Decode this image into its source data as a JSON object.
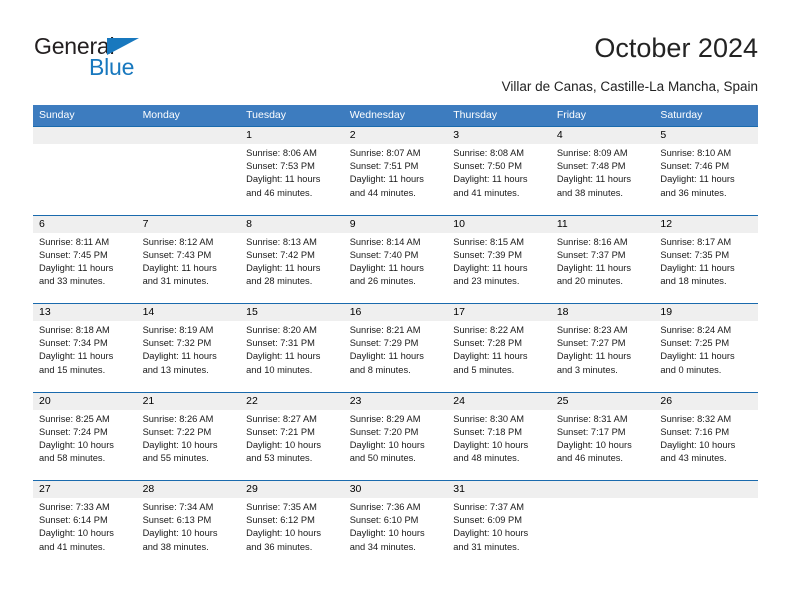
{
  "brand": {
    "name_part1": "General",
    "name_part2": "Blue",
    "accent_color": "#1878be"
  },
  "header": {
    "title": "October 2024",
    "subtitle": "Villar de Canas, Castille-La Mancha, Spain"
  },
  "calendar": {
    "header_bg": "#3d7cbf",
    "week_divider_color": "#1a6aad",
    "day_strip_bg": "#efefef",
    "weekdays": [
      "Sunday",
      "Monday",
      "Tuesday",
      "Wednesday",
      "Thursday",
      "Friday",
      "Saturday"
    ],
    "weeks": [
      [
        {
          "day": "",
          "empty": true
        },
        {
          "day": "",
          "empty": true
        },
        {
          "day": "1",
          "sunrise": "Sunrise: 8:06 AM",
          "sunset": "Sunset: 7:53 PM",
          "daylight1": "Daylight: 11 hours",
          "daylight2": "and 46 minutes."
        },
        {
          "day": "2",
          "sunrise": "Sunrise: 8:07 AM",
          "sunset": "Sunset: 7:51 PM",
          "daylight1": "Daylight: 11 hours",
          "daylight2": "and 44 minutes."
        },
        {
          "day": "3",
          "sunrise": "Sunrise: 8:08 AM",
          "sunset": "Sunset: 7:50 PM",
          "daylight1": "Daylight: 11 hours",
          "daylight2": "and 41 minutes."
        },
        {
          "day": "4",
          "sunrise": "Sunrise: 8:09 AM",
          "sunset": "Sunset: 7:48 PM",
          "daylight1": "Daylight: 11 hours",
          "daylight2": "and 38 minutes."
        },
        {
          "day": "5",
          "sunrise": "Sunrise: 8:10 AM",
          "sunset": "Sunset: 7:46 PM",
          "daylight1": "Daylight: 11 hours",
          "daylight2": "and 36 minutes."
        }
      ],
      [
        {
          "day": "6",
          "sunrise": "Sunrise: 8:11 AM",
          "sunset": "Sunset: 7:45 PM",
          "daylight1": "Daylight: 11 hours",
          "daylight2": "and 33 minutes."
        },
        {
          "day": "7",
          "sunrise": "Sunrise: 8:12 AM",
          "sunset": "Sunset: 7:43 PM",
          "daylight1": "Daylight: 11 hours",
          "daylight2": "and 31 minutes."
        },
        {
          "day": "8",
          "sunrise": "Sunrise: 8:13 AM",
          "sunset": "Sunset: 7:42 PM",
          "daylight1": "Daylight: 11 hours",
          "daylight2": "and 28 minutes."
        },
        {
          "day": "9",
          "sunrise": "Sunrise: 8:14 AM",
          "sunset": "Sunset: 7:40 PM",
          "daylight1": "Daylight: 11 hours",
          "daylight2": "and 26 minutes."
        },
        {
          "day": "10",
          "sunrise": "Sunrise: 8:15 AM",
          "sunset": "Sunset: 7:39 PM",
          "daylight1": "Daylight: 11 hours",
          "daylight2": "and 23 minutes."
        },
        {
          "day": "11",
          "sunrise": "Sunrise: 8:16 AM",
          "sunset": "Sunset: 7:37 PM",
          "daylight1": "Daylight: 11 hours",
          "daylight2": "and 20 minutes."
        },
        {
          "day": "12",
          "sunrise": "Sunrise: 8:17 AM",
          "sunset": "Sunset: 7:35 PM",
          "daylight1": "Daylight: 11 hours",
          "daylight2": "and 18 minutes."
        }
      ],
      [
        {
          "day": "13",
          "sunrise": "Sunrise: 8:18 AM",
          "sunset": "Sunset: 7:34 PM",
          "daylight1": "Daylight: 11 hours",
          "daylight2": "and 15 minutes."
        },
        {
          "day": "14",
          "sunrise": "Sunrise: 8:19 AM",
          "sunset": "Sunset: 7:32 PM",
          "daylight1": "Daylight: 11 hours",
          "daylight2": "and 13 minutes."
        },
        {
          "day": "15",
          "sunrise": "Sunrise: 8:20 AM",
          "sunset": "Sunset: 7:31 PM",
          "daylight1": "Daylight: 11 hours",
          "daylight2": "and 10 minutes."
        },
        {
          "day": "16",
          "sunrise": "Sunrise: 8:21 AM",
          "sunset": "Sunset: 7:29 PM",
          "daylight1": "Daylight: 11 hours",
          "daylight2": "and 8 minutes."
        },
        {
          "day": "17",
          "sunrise": "Sunrise: 8:22 AM",
          "sunset": "Sunset: 7:28 PM",
          "daylight1": "Daylight: 11 hours",
          "daylight2": "and 5 minutes."
        },
        {
          "day": "18",
          "sunrise": "Sunrise: 8:23 AM",
          "sunset": "Sunset: 7:27 PM",
          "daylight1": "Daylight: 11 hours",
          "daylight2": "and 3 minutes."
        },
        {
          "day": "19",
          "sunrise": "Sunrise: 8:24 AM",
          "sunset": "Sunset: 7:25 PM",
          "daylight1": "Daylight: 11 hours",
          "daylight2": "and 0 minutes."
        }
      ],
      [
        {
          "day": "20",
          "sunrise": "Sunrise: 8:25 AM",
          "sunset": "Sunset: 7:24 PM",
          "daylight1": "Daylight: 10 hours",
          "daylight2": "and 58 minutes."
        },
        {
          "day": "21",
          "sunrise": "Sunrise: 8:26 AM",
          "sunset": "Sunset: 7:22 PM",
          "daylight1": "Daylight: 10 hours",
          "daylight2": "and 55 minutes."
        },
        {
          "day": "22",
          "sunrise": "Sunrise: 8:27 AM",
          "sunset": "Sunset: 7:21 PM",
          "daylight1": "Daylight: 10 hours",
          "daylight2": "and 53 minutes."
        },
        {
          "day": "23",
          "sunrise": "Sunrise: 8:29 AM",
          "sunset": "Sunset: 7:20 PM",
          "daylight1": "Daylight: 10 hours",
          "daylight2": "and 50 minutes."
        },
        {
          "day": "24",
          "sunrise": "Sunrise: 8:30 AM",
          "sunset": "Sunset: 7:18 PM",
          "daylight1": "Daylight: 10 hours",
          "daylight2": "and 48 minutes."
        },
        {
          "day": "25",
          "sunrise": "Sunrise: 8:31 AM",
          "sunset": "Sunset: 7:17 PM",
          "daylight1": "Daylight: 10 hours",
          "daylight2": "and 46 minutes."
        },
        {
          "day": "26",
          "sunrise": "Sunrise: 8:32 AM",
          "sunset": "Sunset: 7:16 PM",
          "daylight1": "Daylight: 10 hours",
          "daylight2": "and 43 minutes."
        }
      ],
      [
        {
          "day": "27",
          "sunrise": "Sunrise: 7:33 AM",
          "sunset": "Sunset: 6:14 PM",
          "daylight1": "Daylight: 10 hours",
          "daylight2": "and 41 minutes."
        },
        {
          "day": "28",
          "sunrise": "Sunrise: 7:34 AM",
          "sunset": "Sunset: 6:13 PM",
          "daylight1": "Daylight: 10 hours",
          "daylight2": "and 38 minutes."
        },
        {
          "day": "29",
          "sunrise": "Sunrise: 7:35 AM",
          "sunset": "Sunset: 6:12 PM",
          "daylight1": "Daylight: 10 hours",
          "daylight2": "and 36 minutes."
        },
        {
          "day": "30",
          "sunrise": "Sunrise: 7:36 AM",
          "sunset": "Sunset: 6:10 PM",
          "daylight1": "Daylight: 10 hours",
          "daylight2": "and 34 minutes."
        },
        {
          "day": "31",
          "sunrise": "Sunrise: 7:37 AM",
          "sunset": "Sunset: 6:09 PM",
          "daylight1": "Daylight: 10 hours",
          "daylight2": "and 31 minutes."
        },
        {
          "day": "",
          "empty": true
        },
        {
          "day": "",
          "empty": true
        }
      ]
    ]
  }
}
